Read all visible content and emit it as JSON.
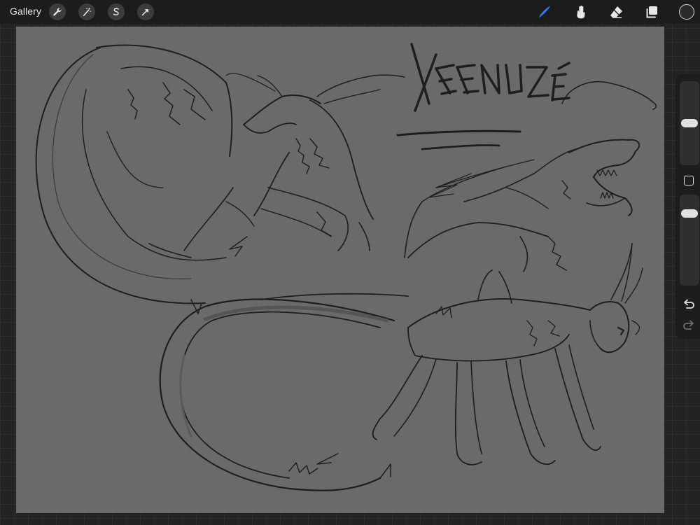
{
  "toolbar": {
    "gallery_label": "Gallery",
    "left_icons": [
      "wrench-icon",
      "magic-wand-icon",
      "selection-s-icon",
      "transform-arrow-icon"
    ],
    "right_icons": [
      "brush-icon",
      "smudge-icon",
      "eraser-icon",
      "layers-icon"
    ],
    "active_tool": "brush",
    "accent_color": "#2f7cf6",
    "current_color": "#2b2b2b"
  },
  "canvas": {
    "background_color": "#6a6a6a",
    "signature_text": "XEENUZÉ",
    "ink_color": "#1e1e1e"
  },
  "sidebar": {
    "brush_size_level": 0.5,
    "opacity_level": 0.85,
    "icons": [
      "modify-square-icon",
      "undo-icon",
      "redo-icon"
    ]
  }
}
